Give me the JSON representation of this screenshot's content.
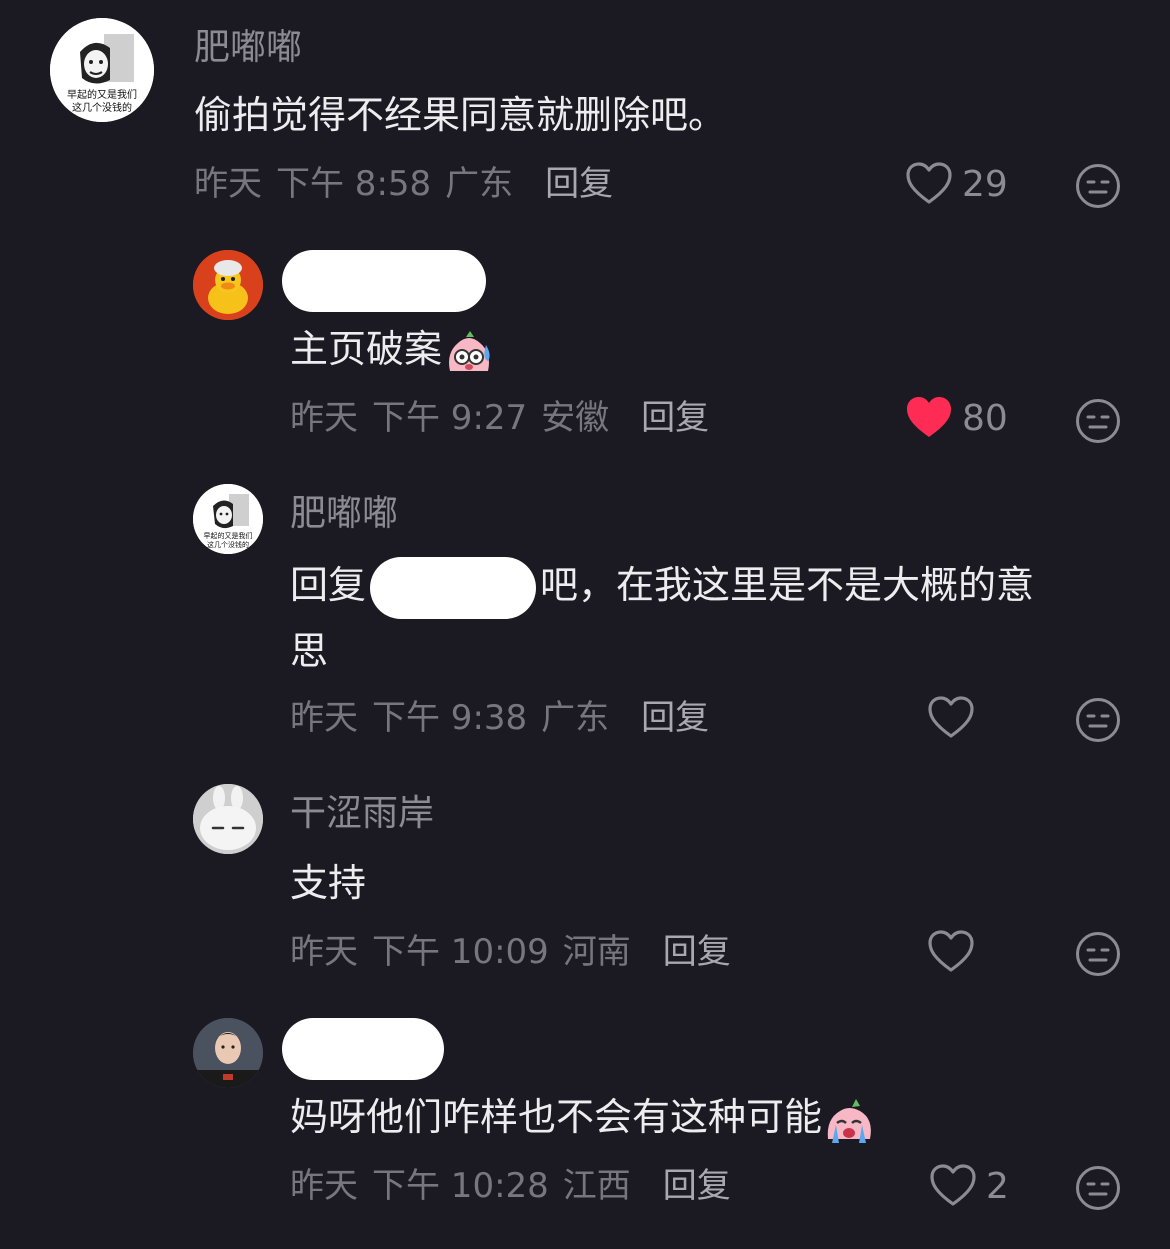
{
  "comments": [
    {
      "username": "肥嘟嘟",
      "text": "偷拍觉得不经果同意就删除吧。",
      "date": "昨天",
      "time": "下午 8:58",
      "location": "广东",
      "reply_label": "回复",
      "likes": "29",
      "liked": false,
      "avatar_caption_1": "早起的又是我们",
      "avatar_caption_2": "这几个没钱的"
    },
    {
      "username": "",
      "text": "主页破案",
      "emoji": "sweat-face-emoji",
      "date": "昨天",
      "time": "下午 9:27",
      "location": "安徽",
      "reply_label": "回复",
      "likes": "80",
      "liked": true
    },
    {
      "username": "肥嘟嘟",
      "reply_prefix": "回复",
      "text_after": "吧，在我这里是不是大概的意",
      "text_line2": "思",
      "date": "昨天",
      "time": "下午 9:38",
      "location": "广东",
      "reply_label": "回复",
      "likes": "",
      "liked": false,
      "avatar_caption_1": "早起的又是我们",
      "avatar_caption_2": "这几个没钱的"
    },
    {
      "username": "干涩雨岸",
      "text": "支持",
      "date": "昨天",
      "time": "下午 10:09",
      "location": "河南",
      "reply_label": "回复",
      "likes": "",
      "liked": false
    },
    {
      "username": "",
      "text": "妈呀他们咋样也不会有这种可能",
      "emoji": "crying-face-emoji",
      "date": "昨天",
      "time": "下午 10:28",
      "location": "江西",
      "reply_label": "回复",
      "likes": "2",
      "liked": false
    }
  ],
  "colors": {
    "background": "#1b1a22",
    "primary_text": "#ededf0",
    "secondary_text": "#77767e",
    "liked_heart": "#fe2c55"
  },
  "icons": {
    "like": "heart-outline-icon",
    "liked": "heart-filled-icon",
    "dislike": "meh-face-icon"
  }
}
